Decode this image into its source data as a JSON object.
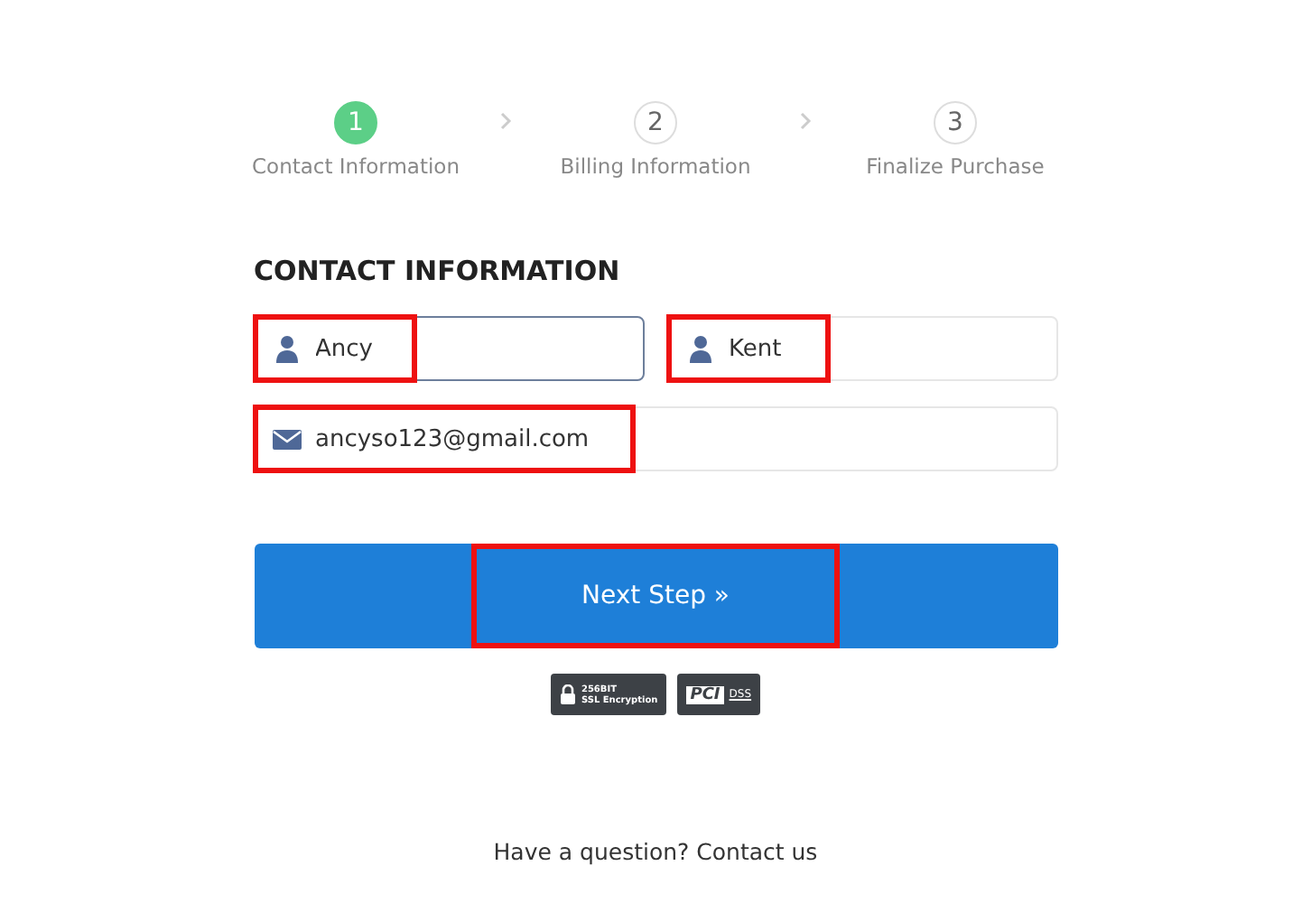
{
  "steps": [
    {
      "number": "1",
      "label": "Contact Information",
      "selected": true
    },
    {
      "number": "2",
      "label": "Billing Information",
      "selected": false
    },
    {
      "number": "3",
      "label": "Finalize Purchase",
      "selected": false
    }
  ],
  "heading": "CONTACT INFORMATION",
  "name_fields": [
    {
      "kind": "person",
      "value": "Ancy",
      "focused": true,
      "highlighted": true
    },
    {
      "kind": "person",
      "value": "Kent",
      "focused": false,
      "highlighted": true
    }
  ],
  "email_field": {
    "kind": "email",
    "value": "ancyso123@gmail.com",
    "focused": false,
    "highlighted": true
  },
  "next_button": {
    "label": "Next Step »",
    "highlighted": true
  },
  "badges": {
    "ssl": {
      "line_1": "256BIT",
      "line_2": "SSL Encryption"
    },
    "pci": {
      "line_1": "PCI",
      "line_2": "DSS"
    }
  },
  "footer": "Have a question? Contact us"
}
